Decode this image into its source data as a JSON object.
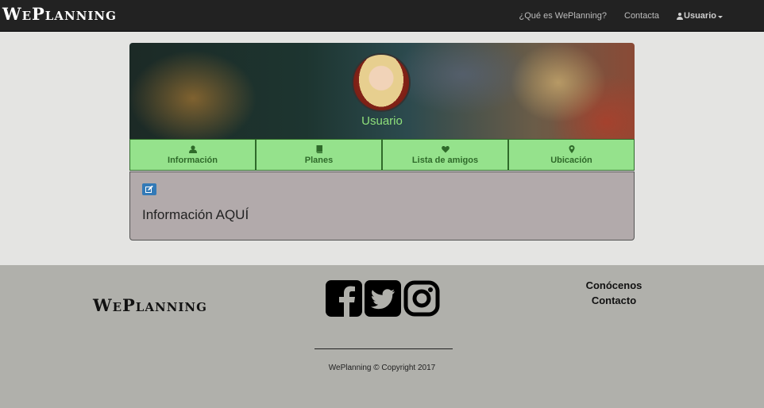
{
  "navbar": {
    "brand": "WePlanning",
    "links": [
      "¿Qué es WePlanning?",
      "Contacta"
    ],
    "user_label": "Usuario"
  },
  "profile": {
    "username": "Usuario"
  },
  "tabs": [
    {
      "label": "Información",
      "icon": "user-icon"
    },
    {
      "label": "Planes",
      "icon": "book-icon"
    },
    {
      "label": "Lista de amigos",
      "icon": "heart-icon"
    },
    {
      "label": "Ubicación",
      "icon": "map-marker-icon"
    }
  ],
  "info": {
    "text": "Información AQUÍ",
    "edit_icon": "edit-icon"
  },
  "footer": {
    "brand": "WePlanning",
    "social": [
      "facebook-icon",
      "twitter-icon",
      "instagram-icon"
    ],
    "links": [
      "Conócenos",
      "Contacto"
    ],
    "copyright": "WePlanning © Copyright 2017"
  },
  "colors": {
    "navbar_bg": "#222222",
    "tab_bg": "#95e28c",
    "tab_text": "#2f6a2a",
    "username": "#8fe07b",
    "info_bg": "#b2aaab",
    "footer_bg": "#b0b0ab",
    "edit_button": "#337ab7"
  }
}
